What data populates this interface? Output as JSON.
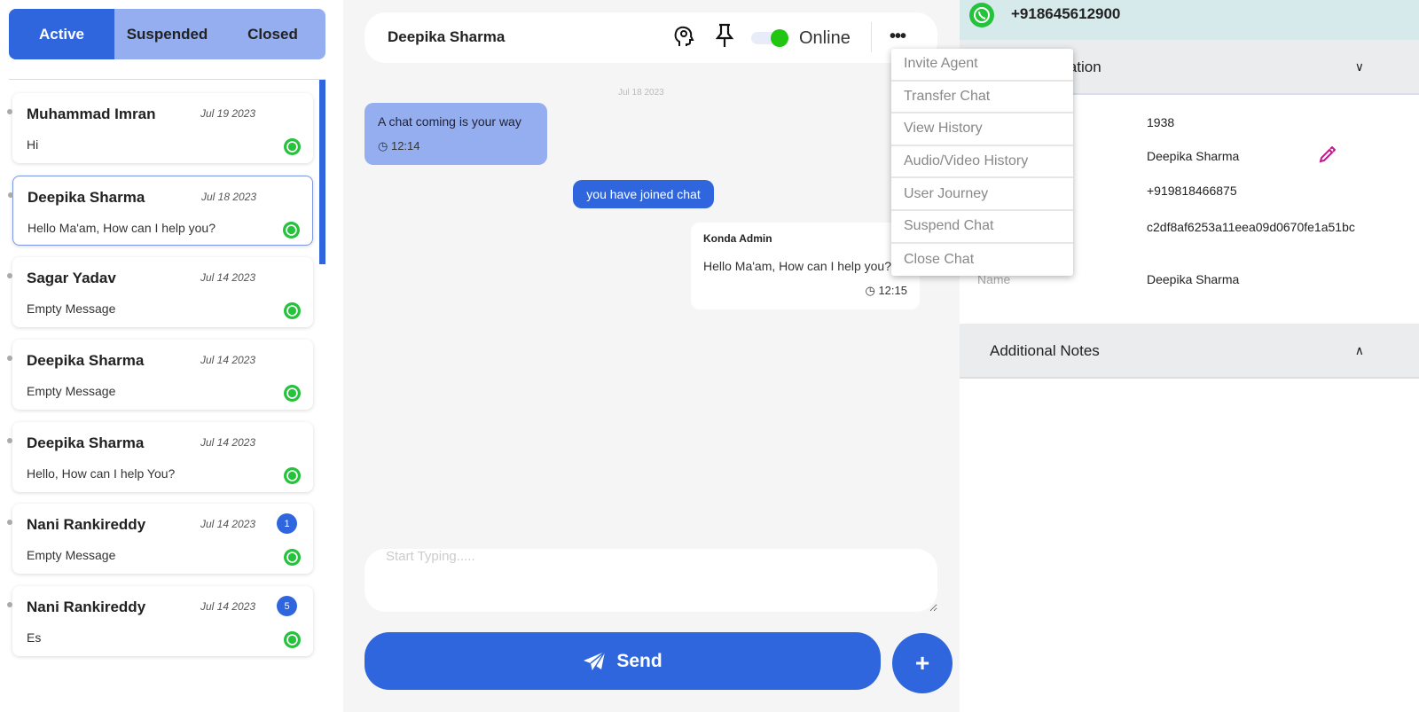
{
  "tabs": [
    {
      "label": "Active",
      "active": true
    },
    {
      "label": "Suspended"
    },
    {
      "label": "Closed"
    }
  ],
  "chats": [
    {
      "name": "Muhammad Imran",
      "date": "Jul 19 2023",
      "message": "Hi",
      "badge": null
    },
    {
      "name": "Deepika Sharma",
      "date": "Jul 18 2023",
      "message": "Hello Ma'am, How can I help you?",
      "badge": null,
      "selected": true
    },
    {
      "name": "Sagar Yadav",
      "date": "Jul 14 2023",
      "message": "Empty Message",
      "badge": null
    },
    {
      "name": "Deepika Sharma",
      "date": "Jul 14 2023",
      "message": "Empty Message",
      "badge": null
    },
    {
      "name": "Deepika Sharma",
      "date": "Jul 14 2023",
      "message": "Hello, How can I help You?",
      "badge": null
    },
    {
      "name": "Nani Rankireddy",
      "date": "Jul 14 2023",
      "message": "Empty Message",
      "badge": "1"
    },
    {
      "name": "Nani Rankireddy",
      "date": "Jul 14 2023",
      "message": "Es",
      "badge": "5"
    }
  ],
  "header": {
    "name": "Deepika Sharma",
    "status": "Online",
    "status_color": "#22c512"
  },
  "conversation": {
    "date": "Jul 18 2023",
    "incoming": {
      "text": "A chat coming is your way",
      "time": "12:14"
    },
    "system": "you have joined chat",
    "outgoing": {
      "sender": "Konda Admin",
      "text": "Hello Ma'am, How can I help you?",
      "time": "12:15"
    }
  },
  "composer": {
    "placeholder": "Start Typing.....",
    "send_label": "Send",
    "plus_label": "+"
  },
  "menu": [
    "Invite Agent",
    "Transfer Chat",
    "View History",
    "Audio/Video History",
    "User Journey",
    "Suspend Chat",
    "Close Chat"
  ],
  "right": {
    "phone": "+918645612900",
    "info_title": "User Information",
    "info_values": [
      "1938",
      "Deepika Sharma",
      "+919818466875",
      "c2df8af6253a11eea09d0670fe1a51bc",
      "Deepika Sharma"
    ],
    "name_label": "Name",
    "notes_title": "Additional Notes"
  },
  "colors": {
    "accent": "#2f66dd",
    "accent_light": "#94aef0",
    "whatsapp": "#25c23b",
    "edit": "#c0168c"
  }
}
